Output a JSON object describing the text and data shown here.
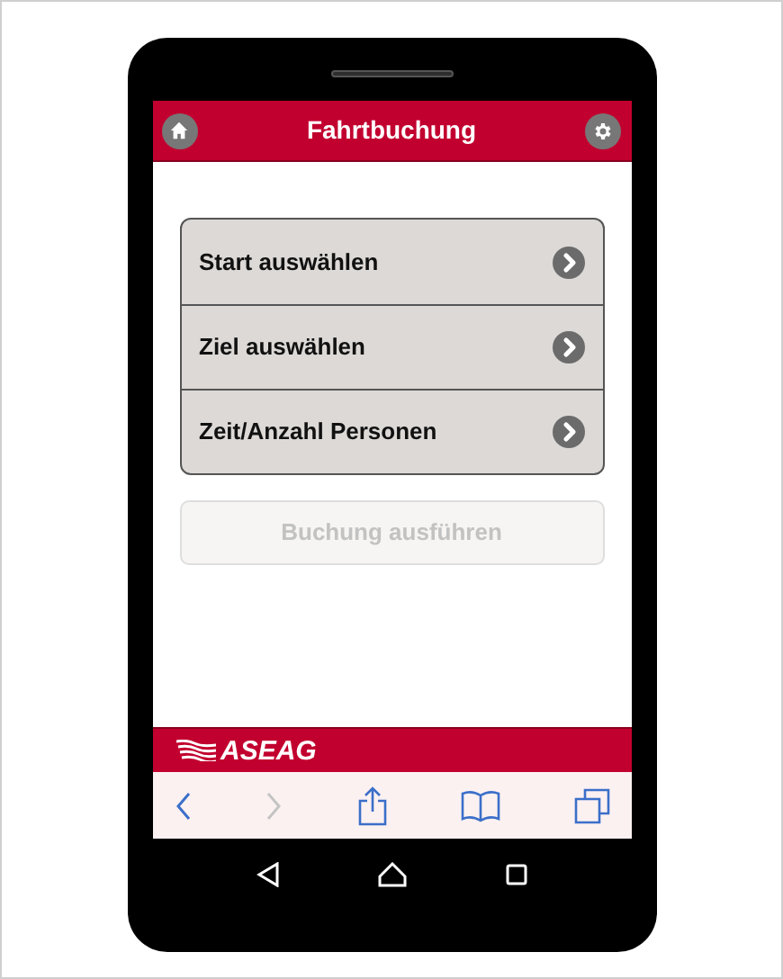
{
  "header": {
    "title": "Fahrtbuchung"
  },
  "menu": [
    {
      "label": "Start auswählen"
    },
    {
      "label": "Ziel auswählen"
    },
    {
      "label": "Zeit/Anzahl Personen"
    }
  ],
  "submit": {
    "label": "Buchung ausführen",
    "disabled": true
  },
  "footer": {
    "logo": "ASEAG"
  },
  "browser_toolbar": {
    "back_disabled": false,
    "forward_disabled": true
  }
}
